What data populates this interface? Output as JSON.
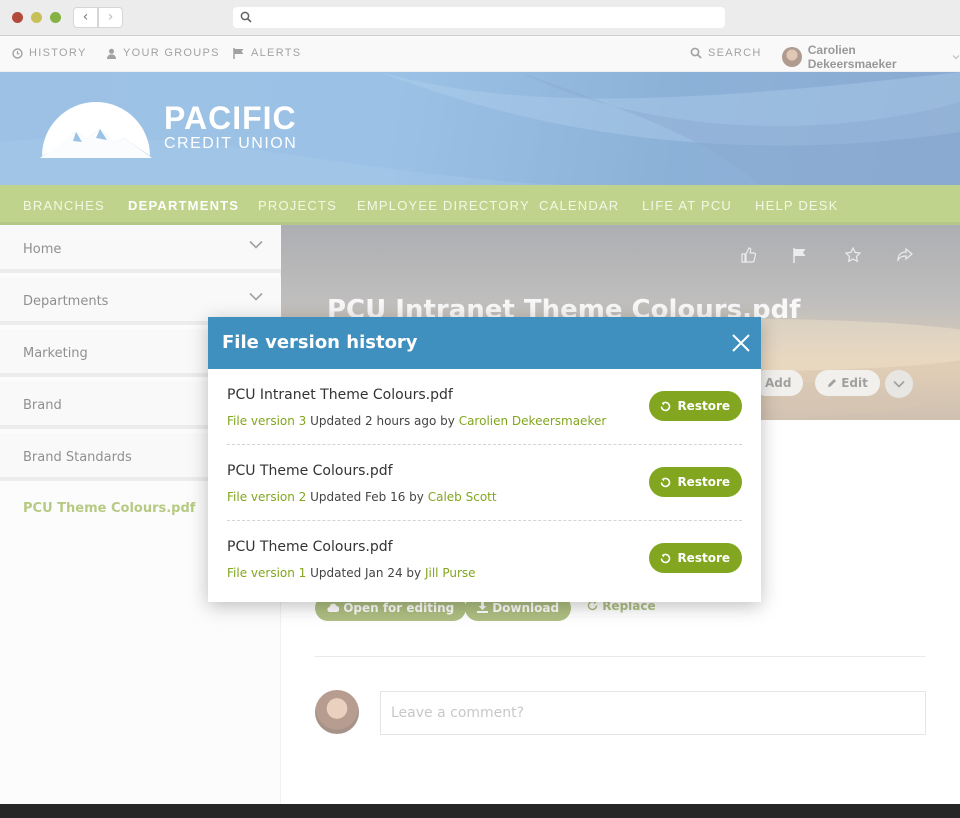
{
  "browser": {
    "back_label": "‹",
    "forward_label": "›"
  },
  "util": {
    "history": "HISTORY",
    "groups": "YOUR GROUPS",
    "alerts": "ALERTS",
    "search": "SEARCH",
    "user_name": "Carolien Dekeersmaeker"
  },
  "brand": {
    "name": "PACIFIC",
    "sub": "CREDIT UNION"
  },
  "nav": {
    "items": [
      "BRANCHES",
      "DEPARTMENTS",
      "PROJECTS",
      "EMPLOYEE DIRECTORY",
      "CALENDAR",
      "LIFE AT PCU",
      "HELP DESK"
    ],
    "active": "DEPARTMENTS"
  },
  "sidebar": {
    "items": [
      "Home",
      "Departments",
      "Marketing",
      "Brand",
      "Brand Standards"
    ],
    "active": "PCU Theme Colours.pdf"
  },
  "content": {
    "title": "PCU Intranet Theme Colours.pdf",
    "add_label": "Add",
    "edit_label": "Edit",
    "open_label": "Open for editing",
    "download_label": "Download",
    "replace_label": "Replace",
    "comment_placeholder": "Leave a comment?"
  },
  "modal": {
    "title": "File version history",
    "restore_label": "Restore",
    "versions": [
      {
        "file": "PCU Intranet Theme Colours.pdf",
        "version": "File version 3",
        "updated": "Updated 2 hours ago by",
        "author": "Carolien Dekeersmaeker"
      },
      {
        "file": "PCU Theme Colours.pdf",
        "version": "File version 2",
        "updated": "Updated Feb 16 by",
        "author": "Caleb Scott"
      },
      {
        "file": "PCU Theme Colours.pdf",
        "version": "File version 1",
        "updated": "Updated Jan 24 by",
        "author": "Jill Purse"
      }
    ]
  },
  "colors": {
    "accent_green": "#82a61f",
    "modal_blue": "#3f8fbf",
    "nav_green": "#8db02f"
  }
}
